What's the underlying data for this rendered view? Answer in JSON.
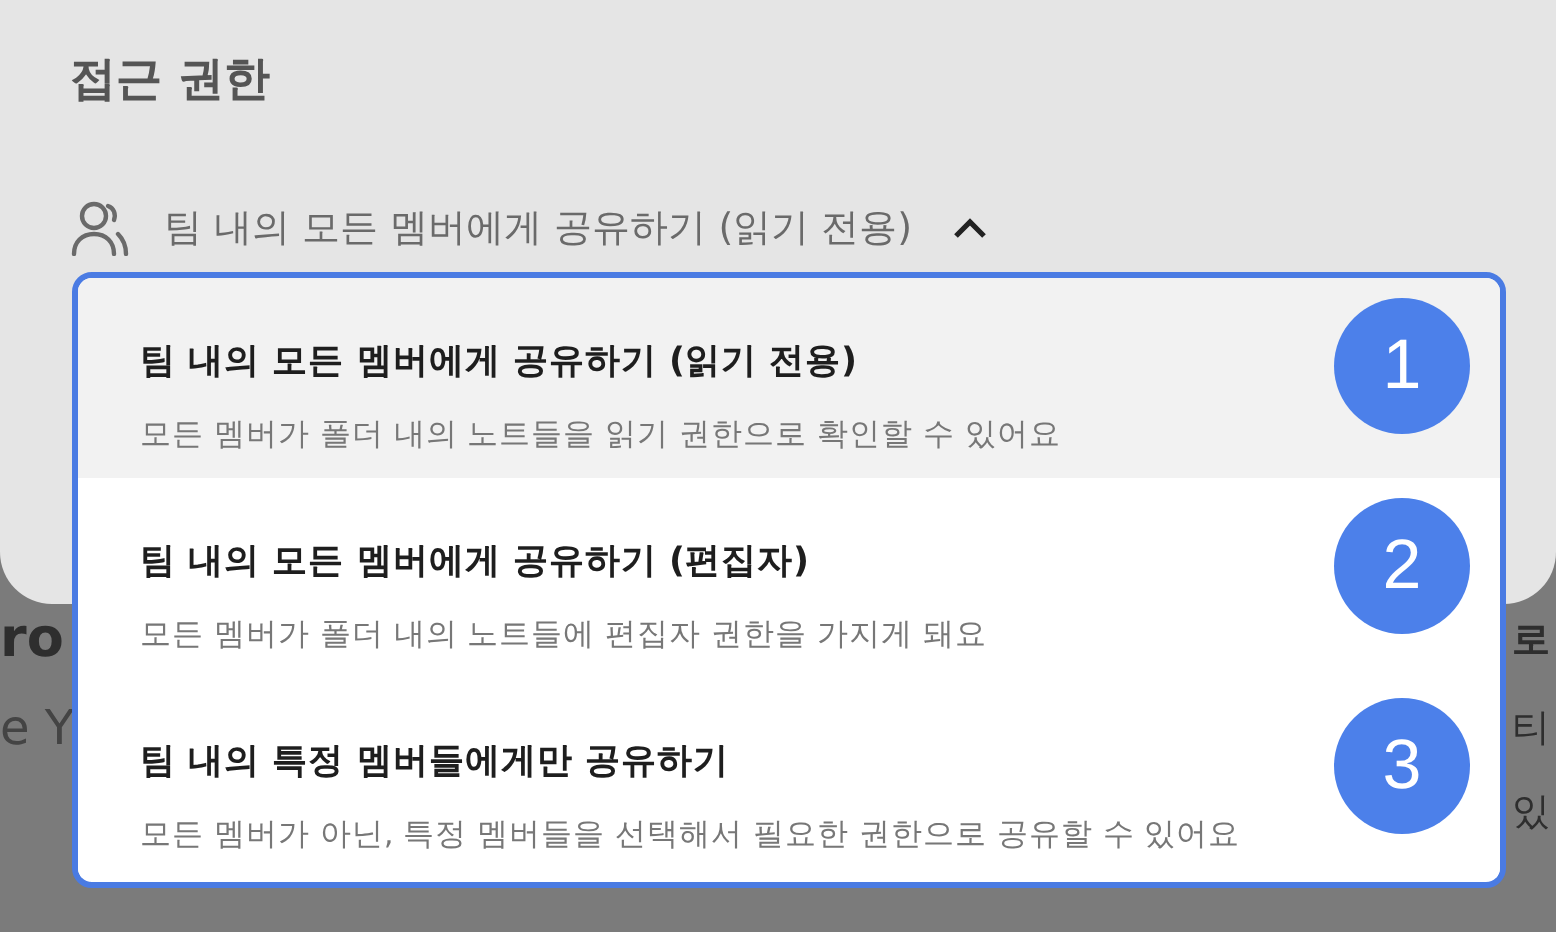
{
  "background_left": [
    {
      "text": "ro",
      "kind": "heading"
    },
    {
      "text": "e Y",
      "kind": "subtext"
    }
  ],
  "background_right": [
    {
      "text": "로",
      "kind": "heading"
    },
    {
      "text": "티",
      "kind": "subtext"
    },
    {
      "text": "있",
      "kind": "subtext"
    }
  ],
  "panel": {
    "title": "접근 권한",
    "dropdown": {
      "value": "팀 내의 모든 멤버에게 공유하기 (읽기 전용)",
      "expanded": true
    }
  },
  "menu": {
    "options": [
      {
        "title": "팀 내의 모든 멤버에게 공유하기 (읽기 전용)",
        "description": "모든 멤버가 폴더 내의 노트들을 읽기 권한으로 확인할 수 있어요",
        "selected": true,
        "marker": "1"
      },
      {
        "title": "팀 내의 모든 멤버에게 공유하기 (편집자)",
        "description": "모든 멤버가 폴더 내의 노트들에 편집자 권한을 가지게 돼요",
        "selected": false,
        "marker": "2"
      },
      {
        "title": "팀 내의 특정 멤버들에게만 공유하기",
        "description": "모든 멤버가 아닌, 특정 멤버들을 선택해서 필요한 권한으로 공유할 수 있어요",
        "selected": false,
        "marker": "3"
      }
    ]
  }
}
